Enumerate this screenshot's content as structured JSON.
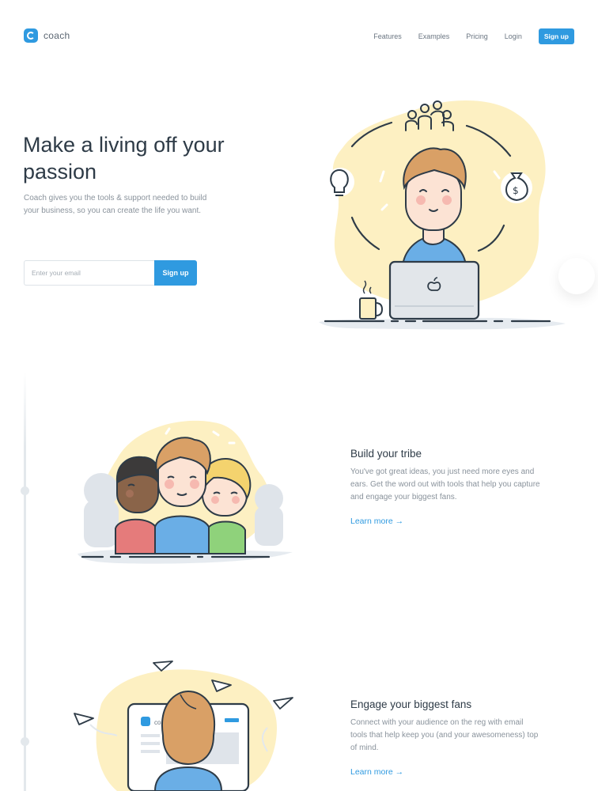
{
  "nav": {
    "logo_text": "coach",
    "links": [
      "Features",
      "Examples",
      "Pricing",
      "Login"
    ],
    "signup_label": "Sign up"
  },
  "hero": {
    "title": "Make a living off your passion",
    "subtitle": "Coach gives you the tools & support needed to build your business, so you can create the life you want.",
    "email_placeholder": "Enter your email",
    "signup_label": "Sign up"
  },
  "features": [
    {
      "title": "Build your tribe",
      "text": "You've got great ideas, you just need more eyes and ears. Get the word out with tools that help you capture and engage your biggest fans.",
      "link": "Learn more →"
    },
    {
      "title": "Engage your biggest fans",
      "text": "Connect with your audience on the reg with email tools that help keep you (and your awesomeness) top of mind.",
      "link": "Learn more →",
      "illus_text": "coa"
    }
  ],
  "colors": {
    "accent": "#2f9ae0",
    "blob": "#fdf0c2",
    "heading": "#2e3b47",
    "body_text": "#8a939c"
  },
  "icons": [
    "logo-mark-icon",
    "group-icon",
    "lightbulb-icon",
    "money-bag-icon",
    "apple-icon",
    "paper-plane-icon",
    "arrow-right-icon"
  ]
}
